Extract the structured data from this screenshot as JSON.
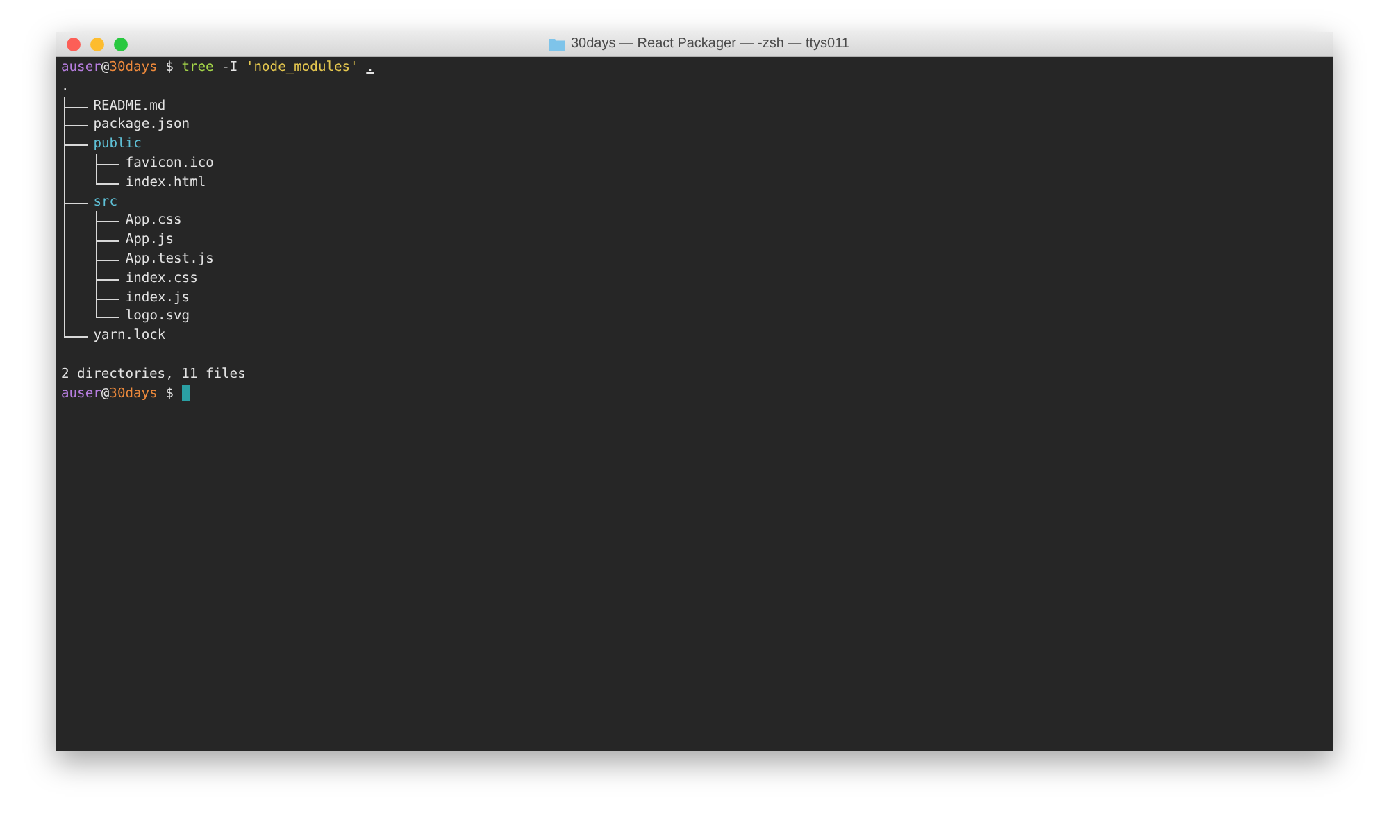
{
  "window": {
    "title": "30days — React Packager — -zsh — ttys011"
  },
  "terminal": {
    "command": {
      "user": "auser",
      "at": "@",
      "host": "30days",
      "symbol": "$",
      "program": "tree",
      "flag": "-I",
      "pattern": "'node_modules'",
      "path": "."
    },
    "tree": {
      "name": ".",
      "kind": "root",
      "children": [
        {
          "name": "README.md",
          "kind": "file"
        },
        {
          "name": "package.json",
          "kind": "file"
        },
        {
          "name": "public",
          "kind": "dir",
          "children": [
            {
              "name": "favicon.ico",
              "kind": "file"
            },
            {
              "name": "index.html",
              "kind": "file"
            }
          ]
        },
        {
          "name": "src",
          "kind": "dir",
          "children": [
            {
              "name": "App.css",
              "kind": "file"
            },
            {
              "name": "App.js",
              "kind": "file"
            },
            {
              "name": "App.test.js",
              "kind": "file"
            },
            {
              "name": "index.css",
              "kind": "file"
            },
            {
              "name": "index.js",
              "kind": "file"
            },
            {
              "name": "logo.svg",
              "kind": "file"
            }
          ]
        },
        {
          "name": "yarn.lock",
          "kind": "file"
        }
      ]
    },
    "summary": "2 directories, 11 files",
    "prompt": {
      "user": "auser",
      "at": "@",
      "host": "30days",
      "symbol": "$"
    },
    "cursor": true
  }
}
